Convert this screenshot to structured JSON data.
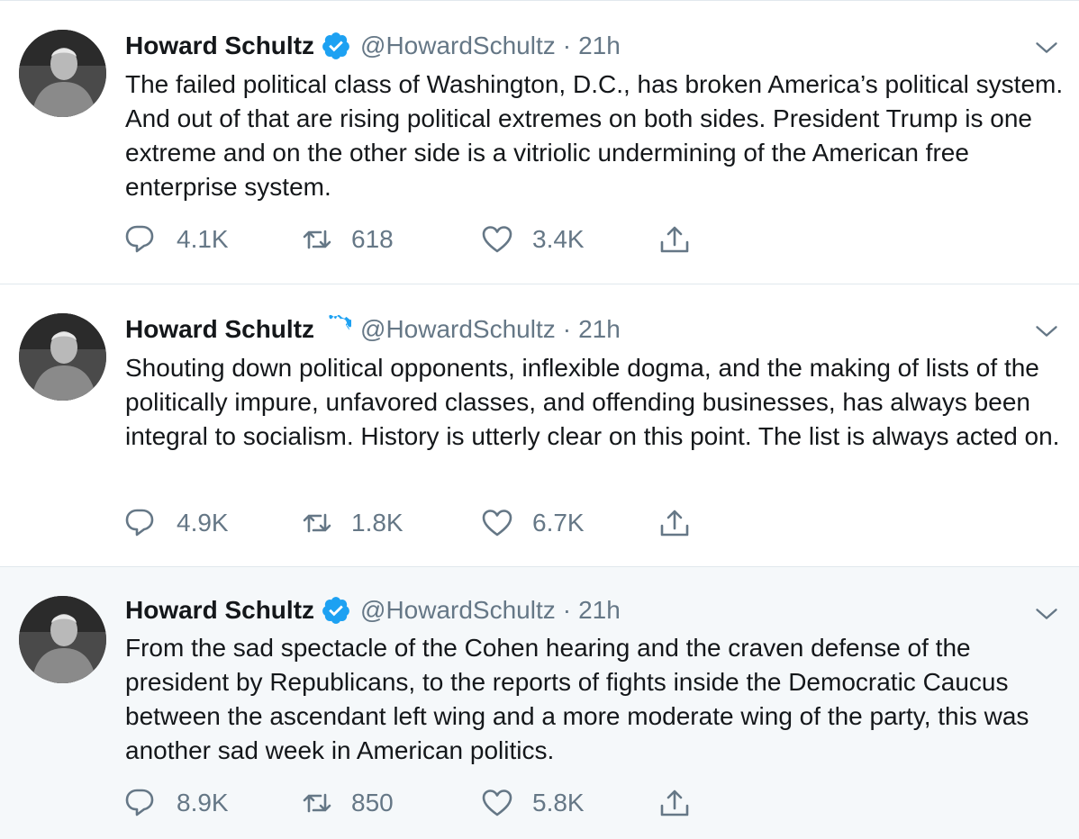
{
  "tweets": [
    {
      "author": {
        "name": "Howard Schultz",
        "handle": "@HowardSchultz",
        "verified": true
      },
      "separator": "·",
      "time": "21h",
      "text": "The failed political class of Washington, D.C., has broken America’s political system. And out of that are rising political extremes on both sides. President Trump is one extreme and on the other side is a vitriolic undermining of the American free enterprise system.",
      "replies": "4.1K",
      "retweets": "618",
      "likes": "3.4K"
    },
    {
      "author": {
        "name": "Howard Schultz",
        "handle": "@HowardSchultz",
        "verified": true
      },
      "separator": "·",
      "time": "21h",
      "text": "Shouting down political opponents, inflexible dogma, and the making of lists of the politically impure, unfavored classes, and offending businesses, has always been integral to socialism. History is utterly clear on this point. The list is always acted on.",
      "replies": "4.9K",
      "retweets": "1.8K",
      "likes": "6.7K"
    },
    {
      "author": {
        "name": "Howard Schultz",
        "handle": "@HowardSchultz",
        "verified": true
      },
      "separator": "·",
      "time": "21h",
      "text": "From the sad spectacle of the Cohen hearing and the craven defense of the president by Republicans, to the reports of fights inside the Democratic Caucus between the ascendant left wing and a more moderate wing of the party, this was another sad week in American politics.",
      "replies": "8.9K",
      "retweets": "850",
      "likes": "5.8K"
    }
  ],
  "icons": {
    "verified": "verified-badge-icon",
    "caret": "chevron-down-icon",
    "reply": "reply-icon",
    "retweet": "retweet-icon",
    "like": "heart-icon",
    "share": "share-icon"
  },
  "colors": {
    "verified": "#1da1f2",
    "muted": "#657786",
    "text": "#14171a",
    "highlight_bg": "#f5f8fa",
    "divider": "#e1e8ed"
  }
}
